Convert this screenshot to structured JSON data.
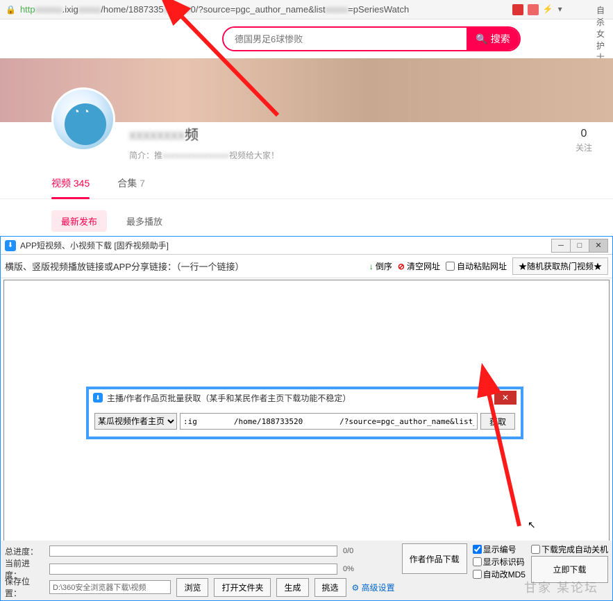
{
  "browser": {
    "url_prefix": "http",
    "url_host": ".ixig",
    "url_path": "/home/1887335",
    "url_query": "0/?source=pgc_author_name&list",
    "url_tail": "=pSeriesWatch",
    "ext_text": "自杀女护士父亲发"
  },
  "search": {
    "placeholder": "德国男足6球惨败",
    "button": "搜索"
  },
  "profile": {
    "name_suffix": "频",
    "bio_prefix": "简介：推",
    "bio_suffix": "视频给大家！",
    "stat_num": "0",
    "stat_label": "关注"
  },
  "tabs": {
    "videos_label": "视频",
    "videos_count": "345",
    "collections_label": "合集",
    "collections_count": "7"
  },
  "sort": {
    "latest": "最新发布",
    "most_played": "最多播放"
  },
  "app": {
    "title": "APP短视频、小视频下载 [固乔视频助手]",
    "toolbar_label": "横版、竖版视频播放链接或APP分享链接：（一行一个链接）",
    "sort_label": "倒序",
    "clear_label": "清空网址",
    "autopaste_label": "自动粘贴网址",
    "random_label": "★随机获取热门视频★"
  },
  "modal": {
    "title": "主播/作者作品页批量获取（某手和某民作者主页下载功能不稳定）",
    "dropdown": "某瓜视频作者主页",
    "input_value": ":ig        /home/188733520        /?source=pgc_author_name&list_entra  =pSeriesWatch",
    "fetch_label": "获取"
  },
  "bottom": {
    "total_label": "总进度：",
    "current_label": "当前进度：",
    "total_pct": "0/0",
    "current_pct": "0%",
    "author_works": "作者作品下载",
    "show_number": "显示编号",
    "show_code": "显示标识码",
    "auto_md5": "自动改MD5",
    "auto_shutdown": "下载完成自动关机",
    "download_now": "立即下载",
    "save_label": "保存位置：",
    "save_path": "D:\\360安全浏览器下载\\视频",
    "browse": "浏览",
    "open_folder": "打开文件夹",
    "generate": "生成",
    "select": "挑选",
    "advanced": "高级设置",
    "incomplete": "下载完成自动"
  },
  "watermark": "甘家      某论坛"
}
